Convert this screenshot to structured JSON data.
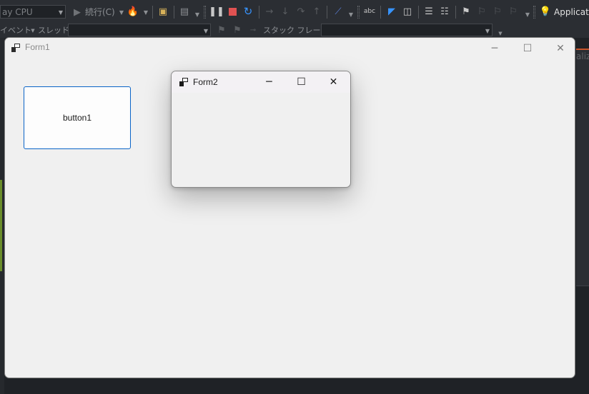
{
  "ide": {
    "platform_combo": "ay CPU",
    "continue_label": "続行(C)",
    "event_label": "イベント",
    "thread_label": "スレッド:",
    "stack_frame_label": "スタック フレーム:",
    "insights_label": "Applicati",
    "right_panel_text": "aliz"
  },
  "form1": {
    "title": "Form1",
    "button1_label": "button1"
  },
  "form2": {
    "title": "Form2"
  },
  "icons": {
    "minimize": "─",
    "maximize": "☐",
    "close": "✕"
  },
  "colors": {
    "ide_bg": "#1f2226",
    "form_bg": "#f0f0f0",
    "button_focus_border": "#0a64c8",
    "stop_red": "#e05252",
    "restart_blue": "#3794ff"
  }
}
